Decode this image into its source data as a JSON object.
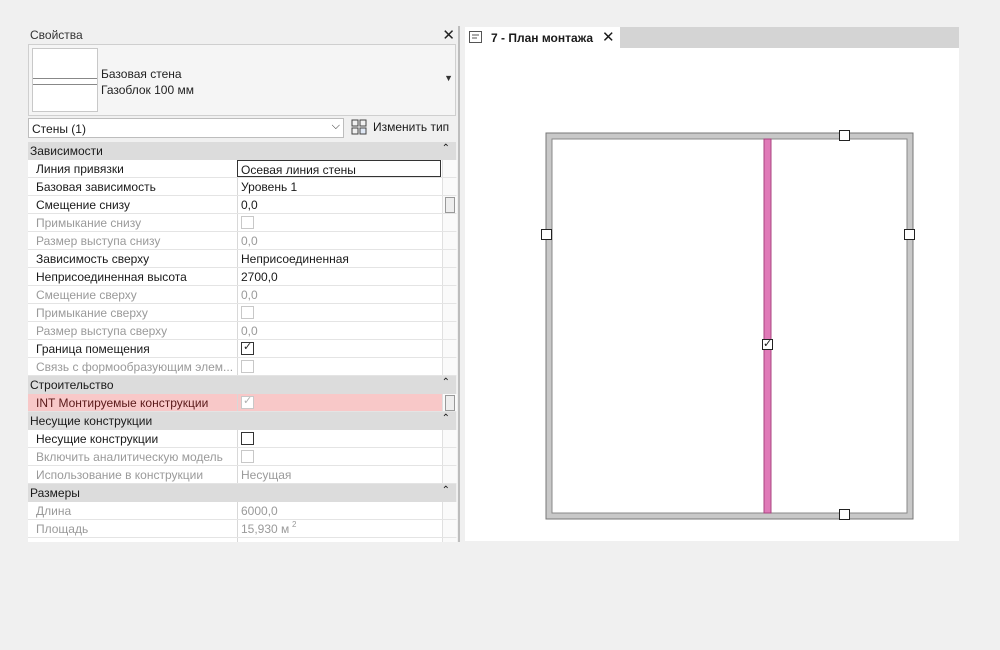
{
  "properties": {
    "title": "Свойства",
    "type_family": "Базовая стена",
    "type_name": "Газоблок 100 мм",
    "filter": "Стены (1)",
    "edit_type": "Изменить тип",
    "sections": [
      {
        "title": "Зависимости",
        "rows": [
          {
            "key": "Линия привязки",
            "value": "Осевая линия стены",
            "editing": true
          },
          {
            "key": "Базовая зависимость",
            "value": "Уровень 1"
          },
          {
            "key": "Смещение снизу",
            "value": "0,0"
          },
          {
            "key": "Примыкание снизу",
            "checkbox": true,
            "checked": false,
            "disabled": true
          },
          {
            "key": "Размер выступа снизу",
            "value": "0,0",
            "disabled": true
          },
          {
            "key": "Зависимость сверху",
            "value": "Неприсоединенная"
          },
          {
            "key": "Неприсоединенная высота",
            "value": "2700,0"
          },
          {
            "key": "Смещение сверху",
            "value": "0,0",
            "disabled": true
          },
          {
            "key": "Примыкание сверху",
            "checkbox": true,
            "checked": false,
            "disabled": true
          },
          {
            "key": "Размер выступа сверху",
            "value": "0,0",
            "disabled": true
          },
          {
            "key": "Граница помещения",
            "checkbox": true,
            "checked": true
          },
          {
            "key": "Связь с формообразующим элем...",
            "checkbox": true,
            "checked": false,
            "disabled": true
          }
        ]
      },
      {
        "title": "Строительство",
        "rows": [
          {
            "key": "INT Монтируемые конструкции",
            "checkbox": true,
            "checked": true,
            "disabled": true,
            "highlight": true
          }
        ]
      },
      {
        "title": "Несущие конструкции",
        "rows": [
          {
            "key": "Несущие конструкции",
            "checkbox": true,
            "checked": false
          },
          {
            "key": "Включить аналитическую модель",
            "checkbox": true,
            "checked": false,
            "disabled": true
          },
          {
            "key": "Использование в конструкции",
            "value": "Несущая",
            "disabled": true
          }
        ]
      },
      {
        "title": "Размеры",
        "rows": [
          {
            "key": "Длина",
            "value": "6000,0",
            "disabled": true
          },
          {
            "key": "Площадь",
            "value": "15,930 м",
            "sup": "2",
            "disabled": true
          },
          {
            "key": "",
            "value": "",
            "disabled": true
          }
        ]
      }
    ]
  },
  "view": {
    "tab_title": "7 - План монтажа",
    "wall_color": "#e07ab8"
  }
}
